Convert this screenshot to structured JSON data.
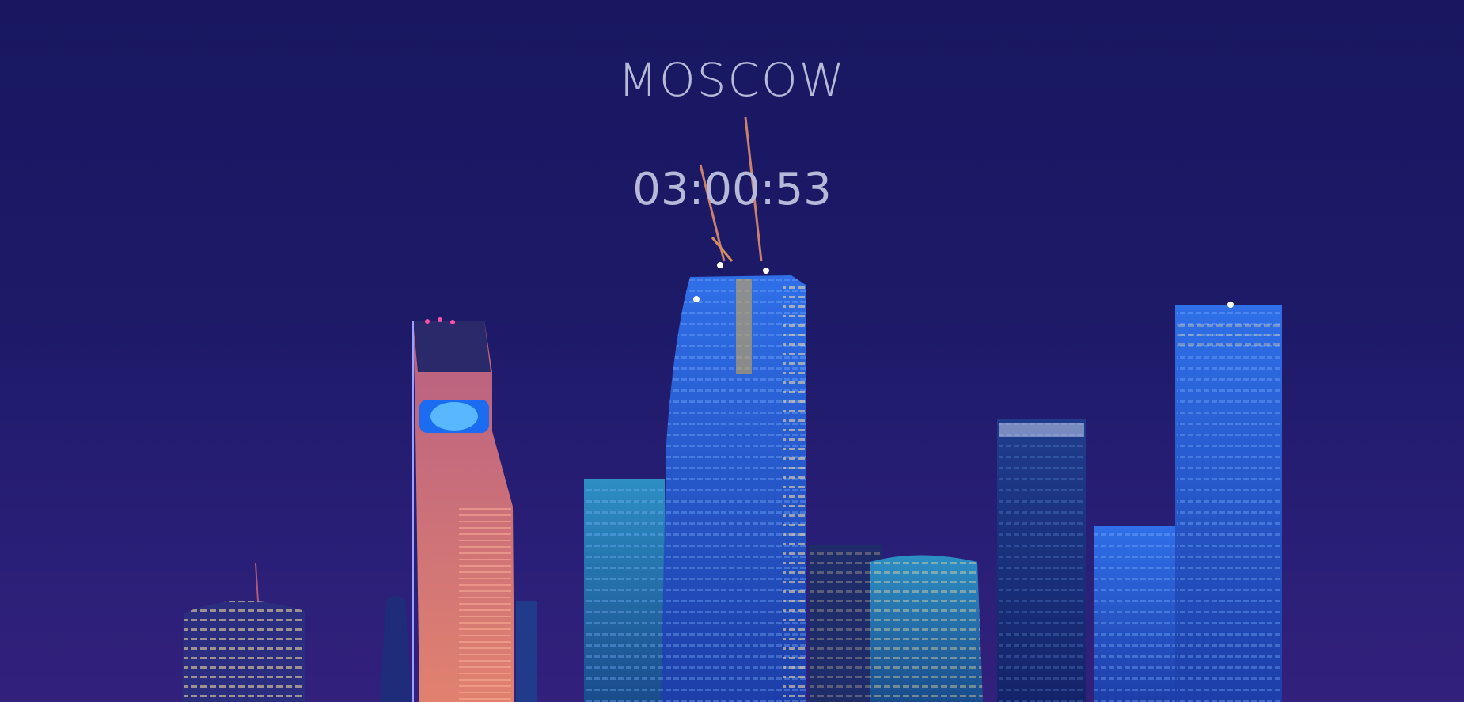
{
  "city": {
    "name": "MOSCOW"
  },
  "clock": {
    "time": "03:00:53"
  },
  "background": {
    "icon": "city-skyline-image",
    "colors": {
      "sky_top": "#181760",
      "sky_bottom": "#33217c",
      "text": "#b7b9d9",
      "tower_blue": "#2a5fd8",
      "tower_pink": "#e07a8a"
    }
  }
}
